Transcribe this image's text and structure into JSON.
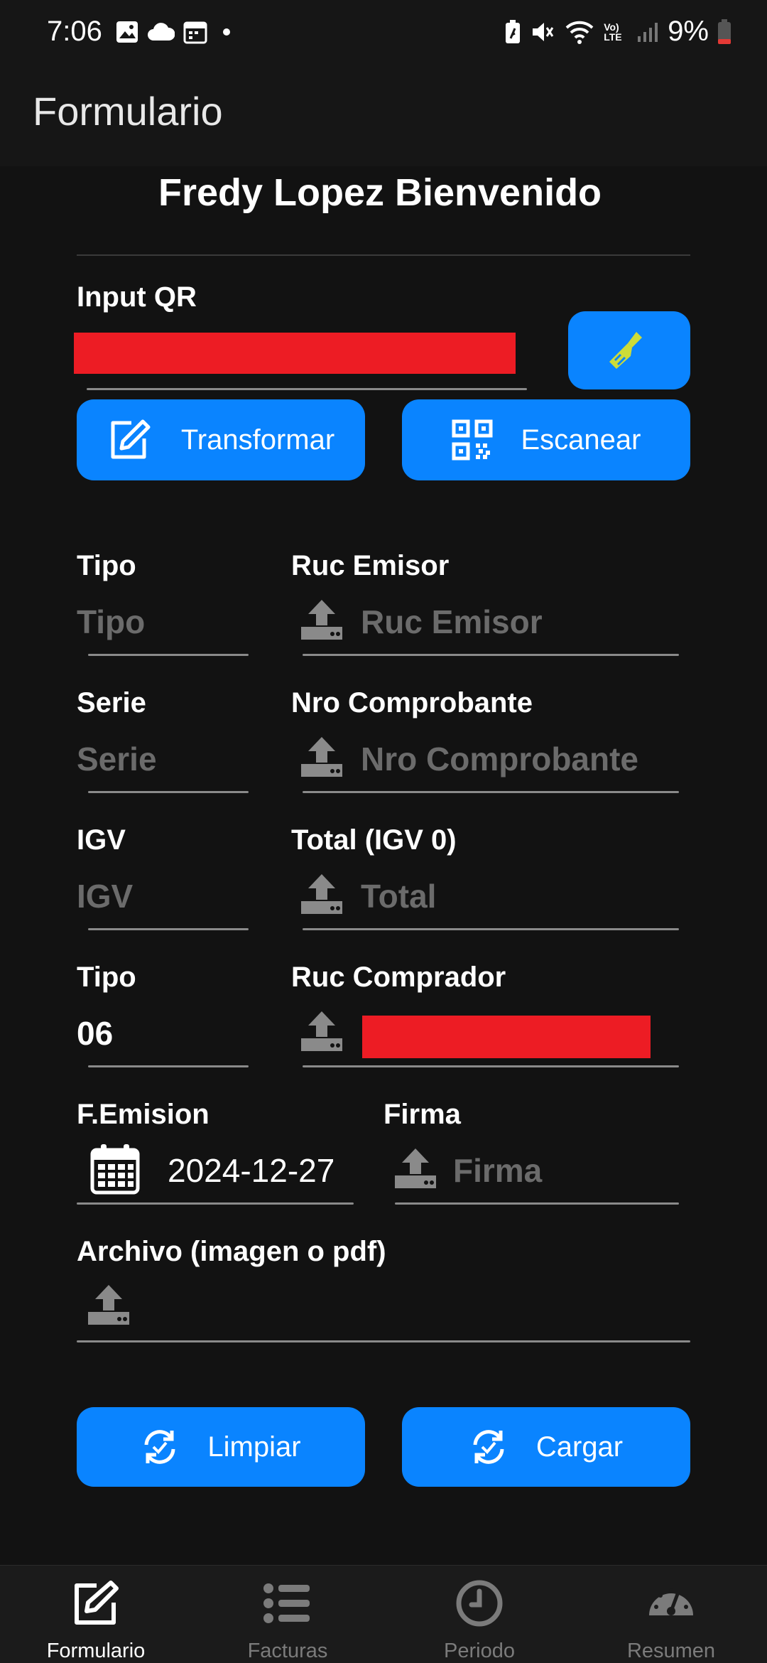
{
  "status": {
    "time": "7:06",
    "battery": "9%",
    "volte": "Vo) LTE"
  },
  "appbar": {
    "title": "Formulario"
  },
  "welcome": "Fredy Lopez Bienvenido",
  "qr": {
    "label": "Input QR",
    "transform_label": "Transformar",
    "scan_label": "Escanear"
  },
  "fields": {
    "tipo1": {
      "label": "Tipo",
      "placeholder": "Tipo"
    },
    "ruc_emisor": {
      "label": "Ruc Emisor",
      "placeholder": "Ruc Emisor"
    },
    "serie": {
      "label": "Serie",
      "placeholder": "Serie"
    },
    "nro": {
      "label": "Nro Comprobante",
      "placeholder": "Nro Comprobante"
    },
    "igv": {
      "label": "IGV",
      "placeholder": "IGV"
    },
    "total": {
      "label": "Total (IGV 0)",
      "placeholder": "Total"
    },
    "tipo2": {
      "label": "Tipo",
      "value": "06"
    },
    "ruc_comprador": {
      "label": "Ruc Comprador"
    },
    "femision": {
      "label": "F.Emision",
      "value": "2024-12-27"
    },
    "firma": {
      "label": "Firma",
      "placeholder": "Firma"
    },
    "archivo": {
      "label": "Archivo (imagen o pdf)"
    }
  },
  "actions": {
    "clear_label": "Limpiar",
    "load_label": "Cargar"
  },
  "nav": [
    {
      "label": "Formulario",
      "icon": "edit-icon",
      "active": true
    },
    {
      "label": "Facturas",
      "icon": "list-icon",
      "active": false
    },
    {
      "label": "Periodo",
      "icon": "clock-icon",
      "active": false
    },
    {
      "label": "Resumen",
      "icon": "gauge-icon",
      "active": false
    }
  ],
  "colors": {
    "accent": "#0a84ff",
    "background": "#121212",
    "redaction": "#ed1c24",
    "broom": "#cddc39"
  }
}
